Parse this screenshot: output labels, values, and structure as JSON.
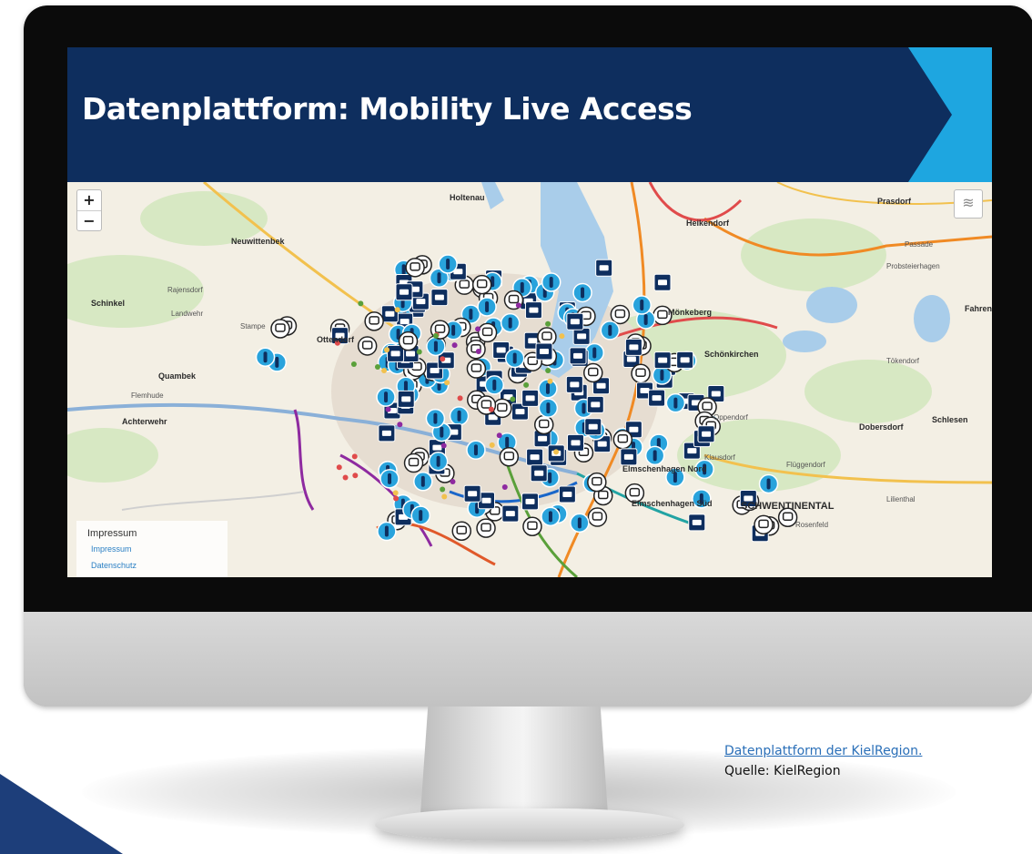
{
  "slide": {
    "title": "Datenplattform: Mobility Live Access"
  },
  "map": {
    "zoom_in": "+",
    "zoom_out": "−",
    "places": [
      "Holtenau",
      "Prasdorf",
      "Heikendorf",
      "Passade",
      "Probsteierhagen",
      "Neuwittenbek",
      "Schinkel",
      "Rajensdorf",
      "Landwehr",
      "Stampe",
      "Ottendorf",
      "Quambek",
      "Flemhude",
      "Achterwehr",
      "Mönkeberg",
      "Schönkirchen",
      "Tökendorf",
      "Oppendorf",
      "Dobersdorf",
      "Schlesen",
      "Klausdorf",
      "Flüggendorf",
      "Elmschenhagen Nord",
      "Elmschenhagen Süd",
      "SCHWENTINENTAL",
      "Rosenfeld",
      "Lilienthal",
      "Fahren"
    ],
    "footer": {
      "heading": "Impressum",
      "impressum_link": "Impressum",
      "datenschutz_link": "Datenschutz"
    }
  },
  "caption": {
    "link": "Datenplattform der KielRegion.",
    "source": "Quelle: KielRegion"
  },
  "colors": {
    "header_bg": "#0e2e5e",
    "accent_cyan": "#1ea6e0",
    "marker_navy": "#0e2e5e",
    "marker_light": "#29a3dc"
  }
}
